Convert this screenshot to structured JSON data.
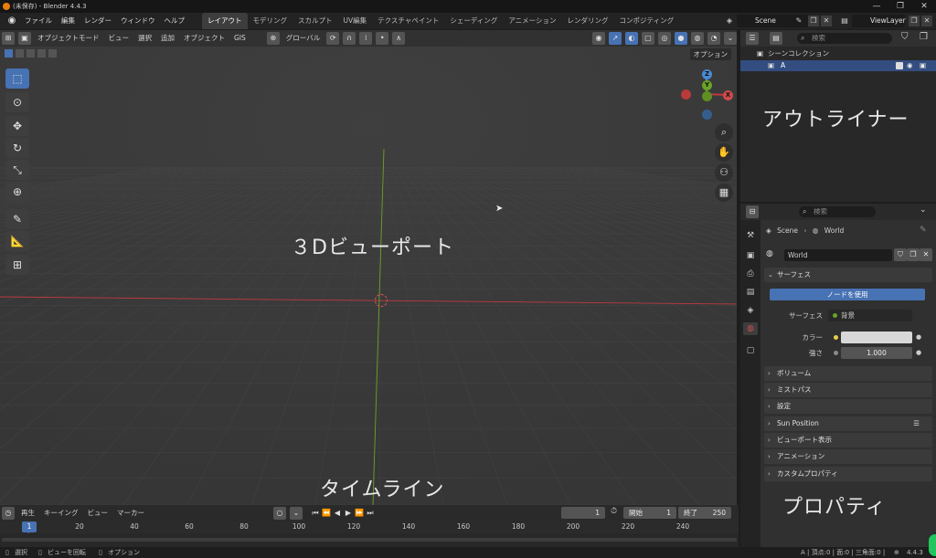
{
  "window": {
    "title": "(未保存) - Blender 4.4.3",
    "minimize": "—",
    "maximize": "❐",
    "close": "✕"
  },
  "menu": {
    "items": [
      "ファイル",
      "編集",
      "レンダー",
      "ウィンドウ",
      "ヘルプ"
    ],
    "workspaces": [
      "レイアウト",
      "モデリング",
      "スカルプト",
      "UV編集",
      "テクスチャペイント",
      "シェーディング",
      "アニメーション",
      "レンダリング",
      "コンポジティング"
    ],
    "active_workspace": "レイアウト",
    "scene": "Scene",
    "view_layer": "ViewLayer"
  },
  "viewport": {
    "mode": "オブジェクトモード",
    "menus": [
      "ビュー",
      "選択",
      "追加",
      "オブジェクト",
      "GIS"
    ],
    "transform_orientation": "グローバル",
    "options_label": "オプション",
    "label": "３Dビューポート",
    "gizmo": {
      "z": "Z",
      "y": "Y",
      "x": "X"
    },
    "colors": {
      "background": "#393939",
      "x_axis": "#c0393f",
      "y_axis": "#6aa329",
      "grid": "#4a4a4a"
    }
  },
  "timeline": {
    "menus": [
      "再生",
      "キーイング",
      "ビュー",
      "マーカー"
    ],
    "current_frame": "1",
    "start_label": "開始",
    "start": "1",
    "end_label": "終了",
    "end": "250",
    "ticks": [
      "20",
      "40",
      "60",
      "80",
      "100",
      "120",
      "140",
      "160",
      "180",
      "200",
      "220",
      "240"
    ],
    "playhead": "1",
    "label": "タイムライン"
  },
  "statusbar": {
    "select": "選択",
    "rotate_view": "ビューを回転",
    "options": "オプション",
    "stats": "A | 頂点:0 | 面:0 | 三角面:0 |",
    "version": "4.4.3"
  },
  "outliner": {
    "search_placeholder": "検索",
    "scene_collection": "シーンコレクション",
    "collection": "A",
    "label": "アウトライナー"
  },
  "properties": {
    "search_placeholder": "検索",
    "breadcrumb_scene": "Scene",
    "breadcrumb_world": "World",
    "world_name": "World",
    "surface_panel": "サーフェス",
    "use_nodes": "ノードを使用",
    "surface_label": "サーフェス",
    "surface_value": "背景",
    "color_label": "カラー",
    "color_value": "#d8d8d8",
    "strength_label": "強さ",
    "strength_value": "1.000",
    "panels": [
      "ボリューム",
      "ミストパス",
      "設定",
      "Sun Position",
      "ビューポート表示",
      "アニメーション",
      "カスタムプロパティ"
    ],
    "label": "プロパティ"
  }
}
